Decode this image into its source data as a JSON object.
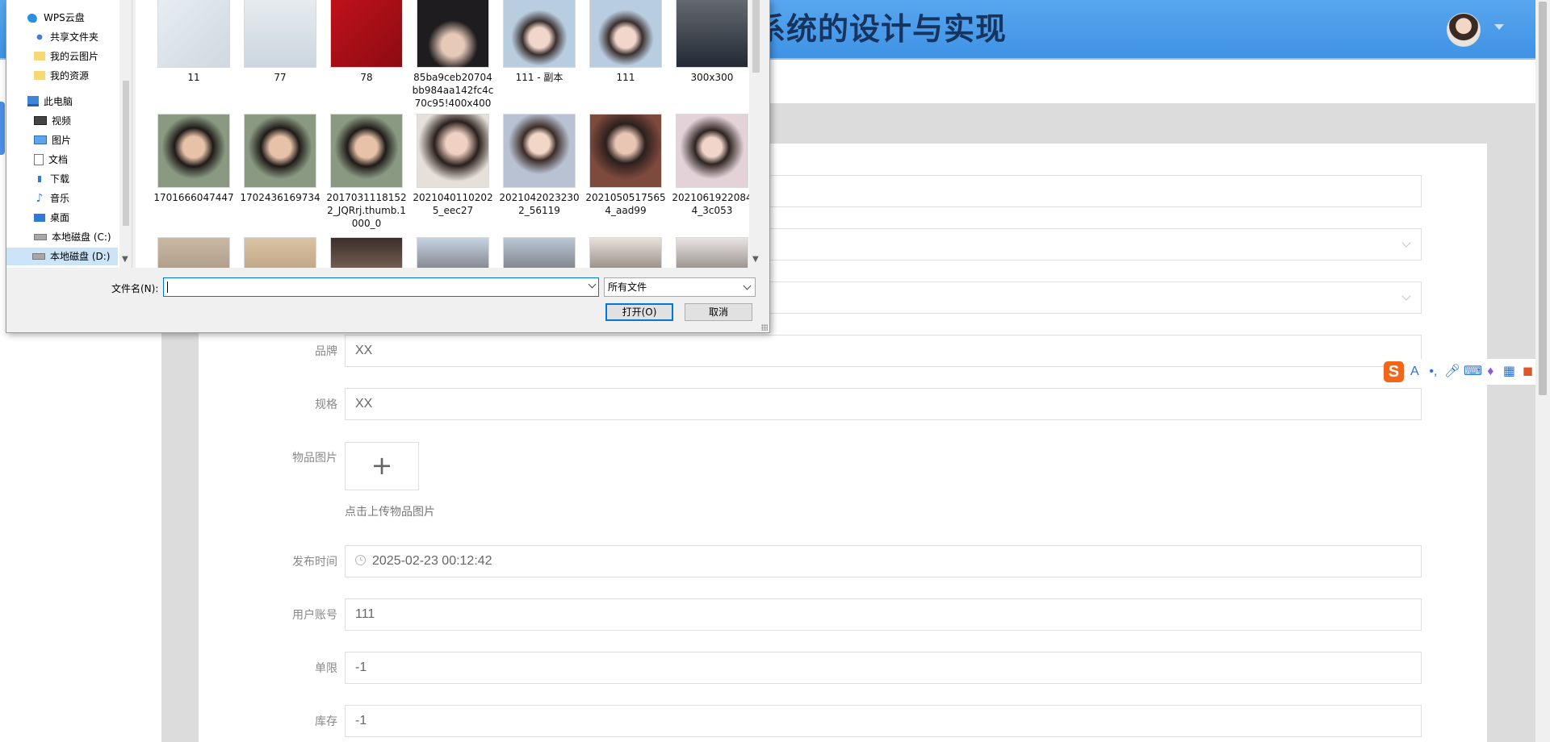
{
  "app": {
    "title": "系统的设计与实现"
  },
  "form": {
    "brand": {
      "label": "品牌",
      "value": "XX"
    },
    "spec": {
      "label": "规格",
      "value": "XX"
    },
    "image": {
      "label": "物品图片",
      "upload_symbol": "+",
      "hint": "点击上传物品图片"
    },
    "publish_time": {
      "label": "发布时间",
      "value": "2025-02-23 00:12:42"
    },
    "account": {
      "label": "用户账号",
      "value": "111"
    },
    "limit": {
      "label": "单限",
      "value": "-1"
    },
    "stock": {
      "label": "库存",
      "value": "-1"
    }
  },
  "ime": {
    "logo": "S",
    "items": [
      "A",
      "•,",
      "mic-icon",
      "keyboard-icon",
      "shirt-icon",
      "grid-icon",
      "toolbox-icon"
    ]
  },
  "dialog": {
    "tree": [
      {
        "label": "WPS云盘",
        "icon": "cloud-icon"
      },
      {
        "label": "共享文件夹",
        "icon": "share-icon"
      },
      {
        "label": "我的云图片",
        "icon": "folder-icon"
      },
      {
        "label": "我的资源",
        "icon": "folder-icon"
      },
      {
        "label": "此电脑",
        "icon": "pc-icon"
      },
      {
        "label": "视频",
        "icon": "video-icon"
      },
      {
        "label": "图片",
        "icon": "picture-icon"
      },
      {
        "label": "文档",
        "icon": "document-icon"
      },
      {
        "label": "下载",
        "icon": "download-icon"
      },
      {
        "label": "音乐",
        "icon": "music-icon"
      },
      {
        "label": "桌面",
        "icon": "desktop-icon"
      },
      {
        "label": "本地磁盘 (C:)",
        "icon": "disk-icon"
      },
      {
        "label": "本地磁盘 (D:)",
        "icon": "disk-icon"
      }
    ],
    "files_row1": [
      "11",
      "77",
      "78",
      "85ba9ceb20704bb984aa142fc4c70c95!400x400",
      "111 - 副本",
      "111",
      "300x300"
    ],
    "files_row2": [
      "1701666047447",
      "1702436169734",
      "20170311181522_JQRrj.thumb.1000_0",
      "20210401102025_eec27",
      "20210420232302_56119",
      "20210505175654_aad99",
      "20210619220844_3c053"
    ],
    "filename_label": "文件名(N):",
    "filename_value": "",
    "filetype_value": "所有文件",
    "open_label": "打开(O)",
    "cancel_label": "取消"
  }
}
